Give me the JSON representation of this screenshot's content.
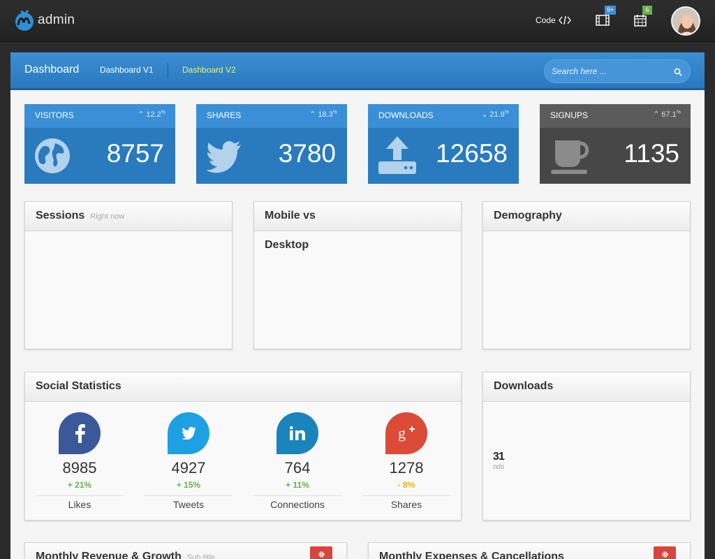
{
  "app": {
    "name": "admin"
  },
  "topbar": {
    "code_label": "Code",
    "media_badge": "9+",
    "calendar_badge": "6",
    "colors": {
      "media_badge": "#3a8fd6",
      "calendar_badge": "#6ab04c"
    }
  },
  "dashboard": {
    "title": "Dashboard",
    "tabs": [
      {
        "label": "Dashboard V1"
      },
      {
        "label": "Dashboard V2"
      }
    ],
    "search_placeholder": "Search here ..."
  },
  "stats": [
    {
      "label": "VISITORS",
      "change": "12.2",
      "unit": "%",
      "value": "8757",
      "icon": "globe-icon"
    },
    {
      "label": "SHARES",
      "change": "18.3",
      "unit": "%",
      "value": "3780",
      "icon": "twitter-bird-icon"
    },
    {
      "label": "DOWNLOADS",
      "change": "21.9",
      "unit": "%",
      "value": "12658",
      "icon": "upload-icon"
    },
    {
      "label": "SIGNUPS",
      "change": "67.1",
      "unit": "%",
      "value": "1135",
      "icon": "coffee-cup-icon"
    }
  ],
  "widgets": {
    "sessions": {
      "title": "Sessions",
      "subtitle": "Right now"
    },
    "mobile": {
      "title_line1": "Mobile vs",
      "title_line2": "Desktop"
    },
    "demography": {
      "title": "Demography"
    },
    "social_stats": {
      "title": "Social Statistics"
    },
    "downloads": {
      "title": "Downloads",
      "partial_value": "31",
      "partial_unit": "nds"
    },
    "revenue": {
      "title": "Monthly Revenue & Growth",
      "subtitle": "Sub title"
    },
    "expenses": {
      "title": "Monthly Expenses & Cancellations"
    }
  },
  "social": [
    {
      "network": "facebook",
      "value": "8985",
      "change": "+ 21%",
      "label": "Likes",
      "color": "#3b5998",
      "change_color": "#6ab04c"
    },
    {
      "network": "twitter",
      "value": "4927",
      "change": "+ 15%",
      "label": "Tweets",
      "color": "#1da1e2",
      "change_color": "#6ab04c"
    },
    {
      "network": "linkedin",
      "value": "764",
      "change": "+ 11%",
      "label": "Connections",
      "color": "#1a84bc",
      "change_color": "#6ab04c"
    },
    {
      "network": "google-plus",
      "value": "1278",
      "change": "- 8%",
      "label": "Shares",
      "color": "#dc4a38",
      "change_color": "#e8b21a"
    }
  ]
}
